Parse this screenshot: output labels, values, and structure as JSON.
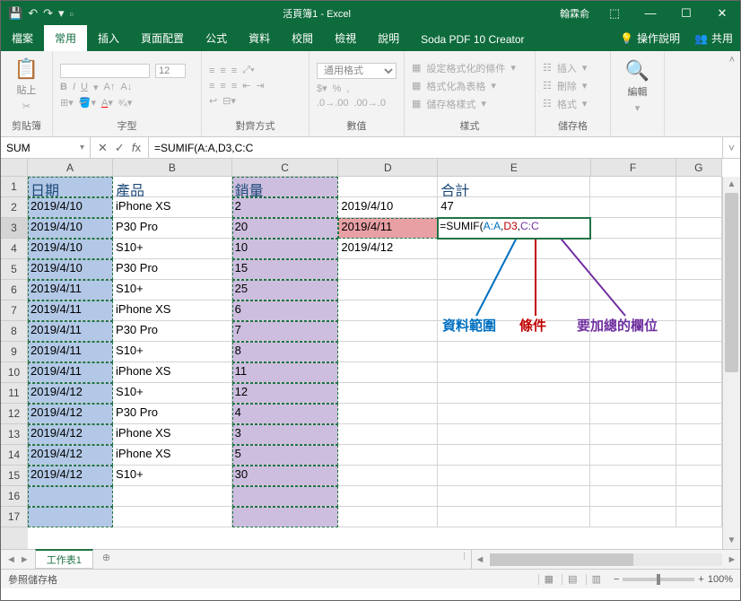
{
  "title": "活頁簿1 - Excel",
  "user": "翰霖俞",
  "tabs": {
    "file": "檔案",
    "home": "常用",
    "insert": "插入",
    "layout": "頁面配置",
    "formulas": "公式",
    "data": "資料",
    "review": "校閱",
    "view": "檢視",
    "help": "說明",
    "soda": "Soda PDF 10 Creator"
  },
  "ribbon_right": {
    "tell": "操作說明",
    "share": "共用"
  },
  "ribbon": {
    "clipboard": {
      "label": "剪貼簿",
      "paste": "貼上"
    },
    "font": {
      "label": "字型",
      "size": "12"
    },
    "align": {
      "label": "對齊方式"
    },
    "number": {
      "label": "數值",
      "format": "通用格式"
    },
    "styles": {
      "label": "樣式",
      "cond": "設定格式化的條件",
      "table": "格式化為表格",
      "cell": "儲存格樣式"
    },
    "cells": {
      "label": "儲存格",
      "insert": "插入",
      "delete": "刪除",
      "format": "格式"
    },
    "edit": {
      "label": "編輯",
      "btn": "編輯"
    }
  },
  "namebox": "SUM",
  "formula": "=SUMIF(A:A,D3,C:C",
  "columns": [
    "A",
    "B",
    "C",
    "D",
    "E",
    "F",
    "G"
  ],
  "rows": [
    "1",
    "2",
    "3",
    "4",
    "5",
    "6",
    "7",
    "8",
    "9",
    "10",
    "11",
    "12",
    "13",
    "14",
    "15",
    "16",
    "17"
  ],
  "headers": {
    "date": "日期",
    "product": "產品",
    "qty": "銷量",
    "total": "合計"
  },
  "table": [
    {
      "date": "2019/4/10",
      "product": "iPhone XS",
      "qty": "2"
    },
    {
      "date": "2019/4/10",
      "product": "P30 Pro",
      "qty": "20"
    },
    {
      "date": "2019/4/10",
      "product": "S10+",
      "qty": "10"
    },
    {
      "date": "2019/4/10",
      "product": "P30 Pro",
      "qty": "15"
    },
    {
      "date": "2019/4/11",
      "product": "S10+",
      "qty": "25"
    },
    {
      "date": "2019/4/11",
      "product": "iPhone XS",
      "qty": "6"
    },
    {
      "date": "2019/4/11",
      "product": "P30 Pro",
      "qty": "7"
    },
    {
      "date": "2019/4/11",
      "product": "S10+",
      "qty": "8"
    },
    {
      "date": "2019/4/11",
      "product": "iPhone XS",
      "qty": "11"
    },
    {
      "date": "2019/4/12",
      "product": "S10+",
      "qty": "12"
    },
    {
      "date": "2019/4/12",
      "product": "P30 Pro",
      "qty": "4"
    },
    {
      "date": "2019/4/12",
      "product": "iPhone XS",
      "qty": "3"
    },
    {
      "date": "2019/4/12",
      "product": "iPhone XS",
      "qty": "5"
    },
    {
      "date": "2019/4/12",
      "product": "S10+",
      "qty": "30"
    }
  ],
  "dcol": [
    "2019/4/10",
    "2019/4/11",
    "2019/4/12"
  ],
  "ecol": {
    "e2": "47"
  },
  "formula_parts": {
    "pre": "=SUMIF(",
    "a": "A:A",
    "c1": ",",
    "b": "D3",
    "c2": ",",
    "c": "C:C"
  },
  "annotations": {
    "range": "資料範圍",
    "criteria": "條件",
    "sumrange": "要加總的欄位"
  },
  "sheet": "工作表1",
  "status": "參照儲存格",
  "zoom": "100%"
}
